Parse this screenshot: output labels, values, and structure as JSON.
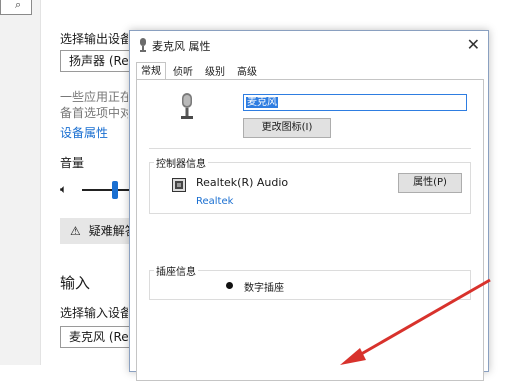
{
  "background": {
    "select_output_label": "选择输出设备",
    "output_device": "扬声器 (Rea",
    "app_note_line1": "一些应用正在",
    "app_note_line2": "备首选项中对",
    "device_properties_link": "设备属性",
    "volume_label": "音量",
    "troubleshoot_label": "疑难解答",
    "input_heading": "输入",
    "select_input_label": "选择输入设备",
    "input_device": "麦克风 (Rea"
  },
  "dialog": {
    "title": "麦克风 属性",
    "tabs": [
      {
        "label": "常规",
        "active": true
      },
      {
        "label": "侦听",
        "active": false
      },
      {
        "label": "级别",
        "active": false
      },
      {
        "label": "高级",
        "active": false
      }
    ],
    "device_name_value": "麦克风",
    "change_icon_button": "更改图标(I)",
    "controller_group_label": "控制器信息",
    "controller_name": "Realtek(R) Audio",
    "controller_link": "Realtek",
    "properties_button": "属性(P)",
    "jack_group_label": "插座信息",
    "jack_text": "数字插座"
  },
  "colors": {
    "accent": "#1a6fd1",
    "annotation_arrow": "#d8322c"
  }
}
